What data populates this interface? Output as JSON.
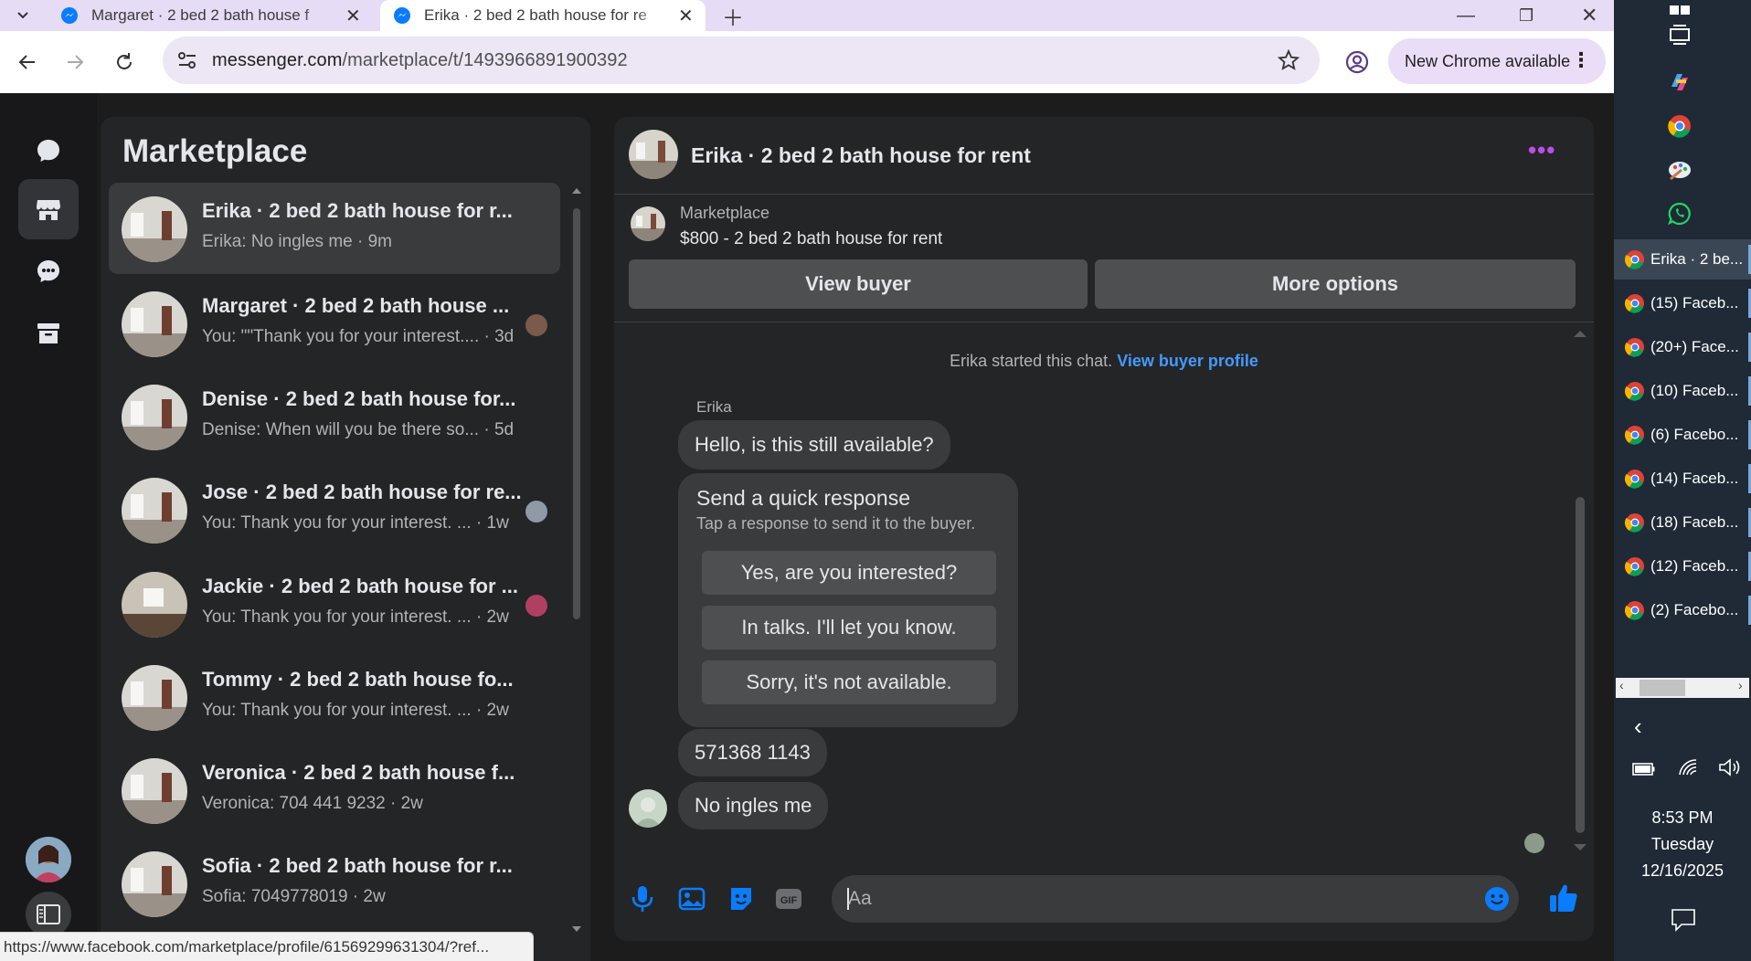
{
  "browser": {
    "tabs": [
      {
        "title": "Margaret · 2 bed 2 bath house f",
        "active": false
      },
      {
        "title": "Erika · 2 bed 2 bath house for re",
        "active": true
      }
    ],
    "url_host": "messenger.com",
    "url_path": "/marketplace/t/1493966891900392",
    "update_chip": "New Chrome available",
    "status_url": "https://www.facebook.com/marketplace/profile/61569299631304/?ref..."
  },
  "messenger": {
    "section_title": "Marketplace",
    "conversations": [
      {
        "name": "Erika · 2 bed 2 bath house for r...",
        "preview": "Erika: No ingles me · 9m",
        "active": true
      },
      {
        "name": "Margaret · 2 bed 2 bath house ...",
        "preview": "You: \"\"Thank you for your interest.... · 3d",
        "active": false
      },
      {
        "name": "Denise · 2 bed 2 bath house for...",
        "preview": "Denise: When will you be there so... · 5d",
        "active": false
      },
      {
        "name": "Jose · 2 bed 2 bath house for re...",
        "preview": "You: Thank you for your interest. ... · 1w",
        "active": false
      },
      {
        "name": "Jackie · 2 bed 2 bath house for ...",
        "preview": "You: Thank you for your interest. ... · 2w",
        "active": false
      },
      {
        "name": "Tommy · 2 bed 2 bath house fo...",
        "preview": "You: Thank you for your interest. ... · 2w",
        "active": false
      },
      {
        "name": "Veronica · 2 bed 2 bath house f...",
        "preview": "Veronica: 704 441 9232 · 2w",
        "active": false
      },
      {
        "name": "Sofia · 2 bed 2 bath house for r...",
        "preview": "Sofia: 7049778019 · 2w",
        "active": false
      }
    ],
    "chat": {
      "title": "Erika · 2 bed 2 bath house for rent",
      "marketplace_label": "Marketplace",
      "listing": "$800 - 2 bed 2 bath house for rent",
      "view_buyer": "View buyer",
      "more_options": "More options",
      "started_text": "Erika started this chat.",
      "view_buyer_profile": "View buyer profile",
      "sender_name": "Erika",
      "messages": [
        "Hello, is this still available?",
        "571368 1143",
        "No ingles  me"
      ],
      "quick_response": {
        "title": "Send a quick response",
        "subtitle": "Tap a response to send it to the buyer.",
        "options": [
          "Yes, are you interested?",
          "In talks. I'll let you know.",
          "Sorry, it's not available."
        ]
      },
      "composer_placeholder": "Aa"
    }
  },
  "taskbar": {
    "windows": [
      "Erika · 2 be...",
      "(15) Faceb...",
      "(20+) Face...",
      "(10) Faceb...",
      "(6) Facebo...",
      "(14) Faceb...",
      "(18) Faceb...",
      "(12) Faceb...",
      "(2) Facebo..."
    ],
    "time": "8:53 PM",
    "day": "Tuesday",
    "date": "12/16/2025"
  },
  "colors": {
    "accent": "#0a7cff",
    "link": "#4599ff",
    "panel": "#242526",
    "bubble": "#3a3b3c"
  }
}
